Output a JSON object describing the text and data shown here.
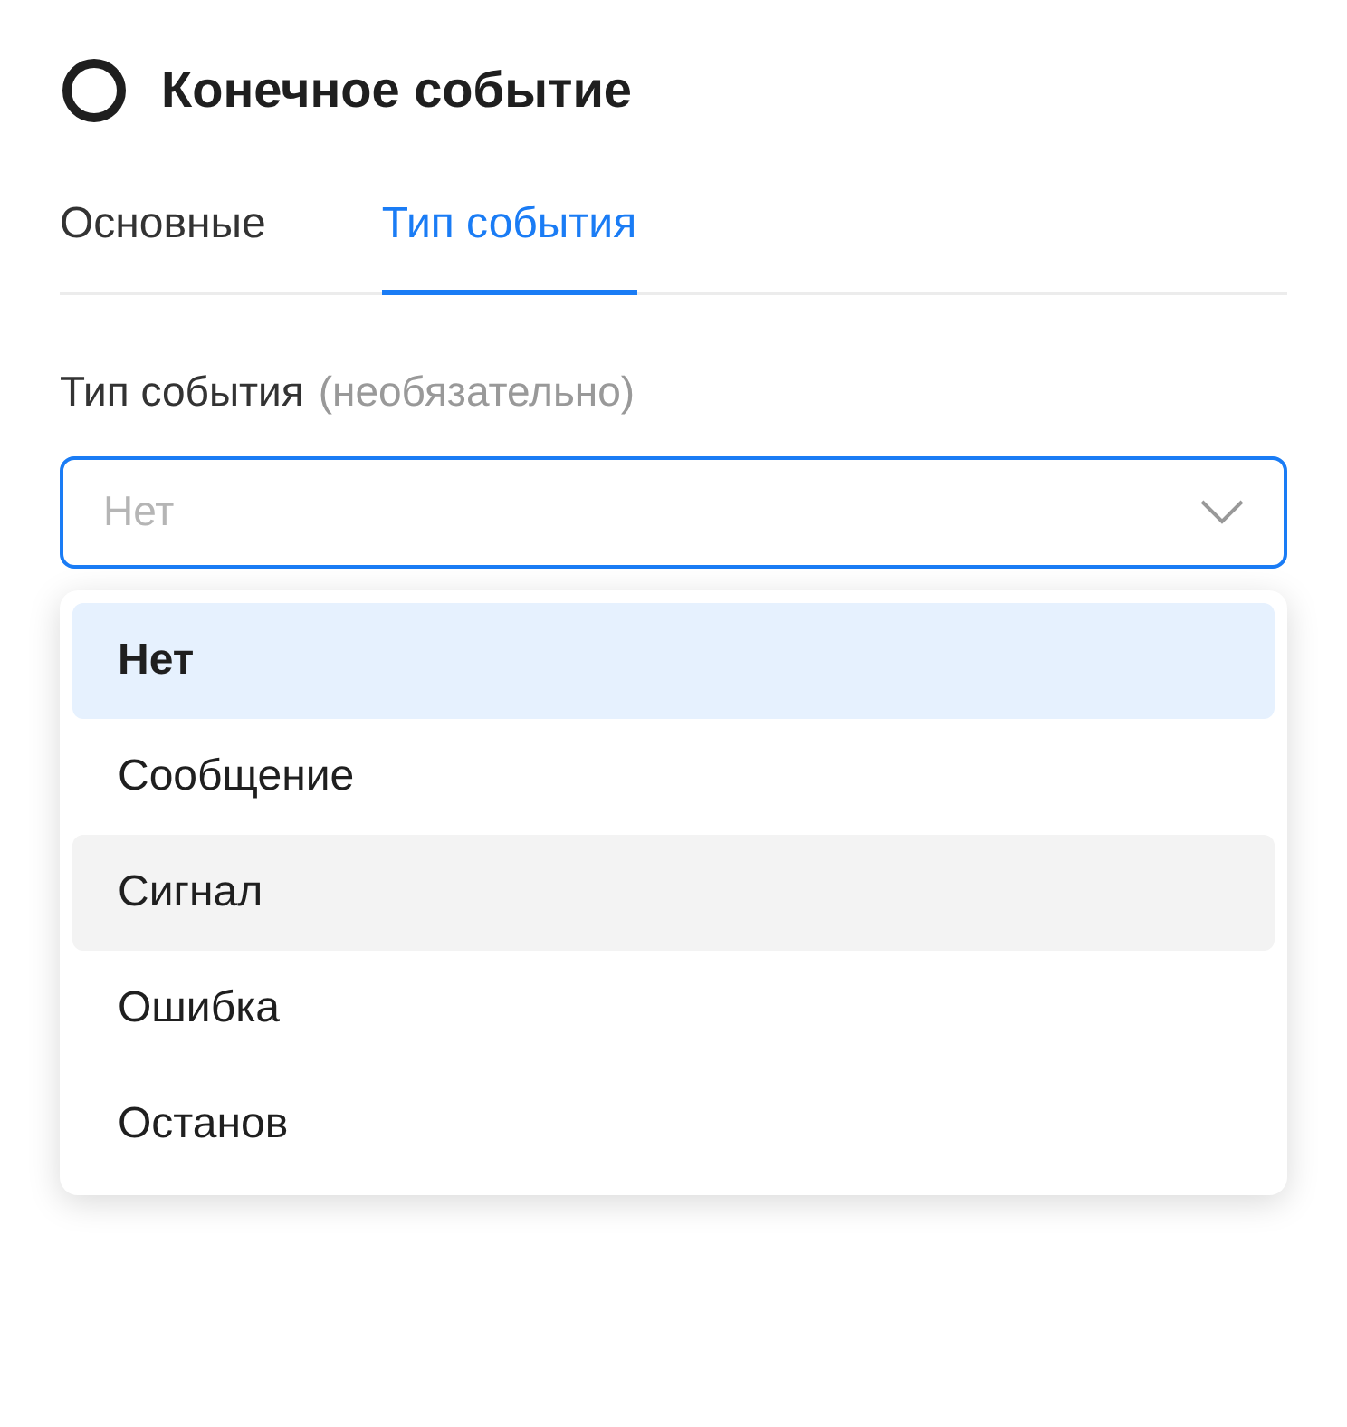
{
  "panel": {
    "title": "Конечное событие"
  },
  "tabs": [
    {
      "label": "Основные",
      "selected": false
    },
    {
      "label": "Тип события",
      "selected": true
    }
  ],
  "field": {
    "label": "Тип события",
    "hint": "(необязательно)",
    "placeholder": "Нет",
    "focused": true
  },
  "options": [
    {
      "label": "Нет",
      "selected": true,
      "hovered": false
    },
    {
      "label": "Сообщение",
      "selected": false,
      "hovered": false
    },
    {
      "label": "Сигнал",
      "selected": false,
      "hovered": true
    },
    {
      "label": "Ошибка",
      "selected": false,
      "hovered": false
    },
    {
      "label": "Останов",
      "selected": false,
      "hovered": false
    }
  ]
}
